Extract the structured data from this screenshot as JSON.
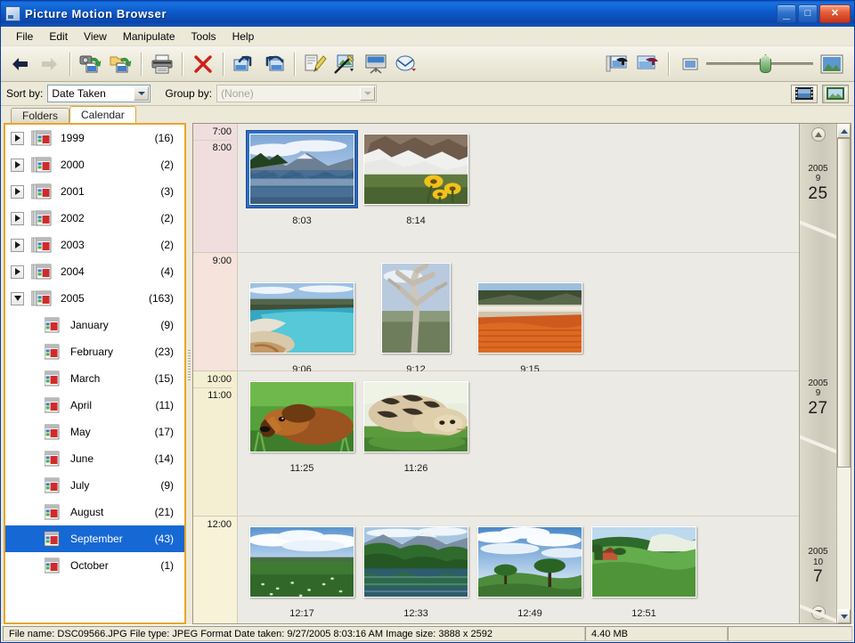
{
  "window": {
    "title": "Picture Motion Browser",
    "icon": "app-window-icon",
    "minimize_label": "_",
    "maximize_label": "□",
    "close_label": "✕"
  },
  "menubar": {
    "items": [
      {
        "label": "File"
      },
      {
        "label": "Edit"
      },
      {
        "label": "View"
      },
      {
        "label": "Manipulate"
      },
      {
        "label": "Tools"
      },
      {
        "label": "Help"
      }
    ]
  },
  "toolbar": {
    "buttons": [
      {
        "name": "back-button",
        "icon": "back-arrow-icon",
        "enabled": true
      },
      {
        "name": "forward-button",
        "icon": "forward-arrow-icon",
        "enabled": false
      },
      {
        "name": "import-camera-button",
        "icon": "camera-import-icon",
        "enabled": true
      },
      {
        "name": "import-folder-button",
        "icon": "folder-import-icon",
        "enabled": true
      },
      {
        "name": "print-button",
        "icon": "printer-icon",
        "enabled": true
      },
      {
        "name": "delete-button",
        "icon": "red-x-delete-icon",
        "enabled": true
      },
      {
        "name": "rotate-left-button",
        "icon": "rotate-left-icon",
        "enabled": true
      },
      {
        "name": "rotate-right-button",
        "icon": "rotate-right-icon",
        "enabled": true
      },
      {
        "name": "edit-image-button",
        "icon": "pencil-edit-icon",
        "enabled": true
      },
      {
        "name": "correct-image-button",
        "icon": "wand-correct-icon",
        "enabled": true
      },
      {
        "name": "slideshow-button",
        "icon": "slideshow-screen-icon",
        "enabled": true
      },
      {
        "name": "email-button",
        "icon": "email-send-icon",
        "enabled": true
      },
      {
        "name": "print-layout-button",
        "icon": "print-layout-icon",
        "enabled": true
      },
      {
        "name": "share-button",
        "icon": "share-icon",
        "enabled": true
      }
    ],
    "zoom": {
      "small_icon": "small-thumbnail-icon",
      "large_icon": "large-thumbnail-icon",
      "value": 50
    }
  },
  "sortbar": {
    "sort_label": "Sort by:",
    "sort_value": "Date Taken",
    "group_label": "Group by:",
    "group_value": "(None)",
    "view_buttons": [
      {
        "name": "view-filmstrip-button",
        "icon": "filmstrip-view-icon",
        "active": false
      },
      {
        "name": "view-single-button",
        "icon": "single-image-view-icon",
        "active": true
      }
    ]
  },
  "sidebar": {
    "tabs": [
      {
        "label": "Folders",
        "active": false
      },
      {
        "label": "Calendar",
        "active": true
      }
    ],
    "tree": [
      {
        "label": "1999",
        "count": "(16)",
        "level": 0,
        "expanded": false,
        "selected": false
      },
      {
        "label": "2000",
        "count": "(2)",
        "level": 0,
        "expanded": false,
        "selected": false
      },
      {
        "label": "2001",
        "count": "(3)",
        "level": 0,
        "expanded": false,
        "selected": false
      },
      {
        "label": "2002",
        "count": "(2)",
        "level": 0,
        "expanded": false,
        "selected": false
      },
      {
        "label": "2003",
        "count": "(2)",
        "level": 0,
        "expanded": false,
        "selected": false
      },
      {
        "label": "2004",
        "count": "(4)",
        "level": 0,
        "expanded": false,
        "selected": false
      },
      {
        "label": "2005",
        "count": "(163)",
        "level": 0,
        "expanded": true,
        "selected": false
      },
      {
        "label": "January",
        "count": "(9)",
        "level": 1,
        "selected": false
      },
      {
        "label": "February",
        "count": "(23)",
        "level": 1,
        "selected": false
      },
      {
        "label": "March",
        "count": "(15)",
        "level": 1,
        "selected": false
      },
      {
        "label": "April",
        "count": "(11)",
        "level": 1,
        "selected": false
      },
      {
        "label": "May",
        "count": "(17)",
        "level": 1,
        "selected": false
      },
      {
        "label": "June",
        "count": "(14)",
        "level": 1,
        "selected": false
      },
      {
        "label": "July",
        "count": "(9)",
        "level": 1,
        "selected": false
      },
      {
        "label": "August",
        "count": "(21)",
        "level": 1,
        "selected": false
      },
      {
        "label": "September",
        "count": "(43)",
        "level": 1,
        "selected": true
      },
      {
        "label": "October",
        "count": "(1)",
        "level": 1,
        "selected": false
      }
    ]
  },
  "timeline": {
    "hour_labels": [
      "7:00",
      "8:00",
      "9:00",
      "10:00",
      "11:00",
      "12:00"
    ],
    "groups": [
      {
        "hours": [
          "7:00",
          "8:00"
        ],
        "band_color": "#f0dede",
        "thumbs": [
          {
            "time": "8:03",
            "orientation": "landscape",
            "selected": true,
            "scene": "mountain-lake-reflection"
          },
          {
            "time": "8:14",
            "orientation": "landscape",
            "selected": false,
            "scene": "snowy-mountain-sunflowers"
          }
        ]
      },
      {
        "hours": [
          "9:00"
        ],
        "band_color": "#f5e3dc",
        "thumbs": [
          {
            "time": "9:06",
            "orientation": "landscape",
            "selected": false,
            "scene": "blue-hot-spring"
          },
          {
            "time": "9:12",
            "orientation": "portrait",
            "selected": false,
            "scene": "dead-tree-branch"
          },
          {
            "time": "9:15",
            "orientation": "landscape",
            "selected": false,
            "scene": "orange-hot-spring"
          }
        ]
      },
      {
        "hours": [
          "10:00",
          "11:00"
        ],
        "band_color": "#f4efd2",
        "thumbs": [
          {
            "time": "11:25",
            "orientation": "landscape",
            "selected": false,
            "scene": "dachshund-puppy-grass"
          },
          {
            "time": "11:26",
            "orientation": "landscape",
            "selected": false,
            "scene": "tabby-kitten-grass"
          }
        ]
      },
      {
        "hours": [
          "12:00"
        ],
        "band_color": "#f7f2d8",
        "thumbs": [
          {
            "time": "12:17",
            "orientation": "landscape",
            "selected": false,
            "scene": "flower-meadow-clouds"
          },
          {
            "time": "12:33",
            "orientation": "landscape",
            "selected": false,
            "scene": "lake-forest-reflection"
          },
          {
            "time": "12:49",
            "orientation": "landscape",
            "selected": false,
            "scene": "two-trees-hill-sky"
          },
          {
            "time": "12:51",
            "orientation": "landscape",
            "selected": false,
            "scene": "green-hill-farmhouse"
          }
        ]
      }
    ]
  },
  "date_ruler": {
    "scroll_up_icon": "scroll-up-arrow-icon",
    "scroll_down_icon": "scroll-down-arrow-icon",
    "marks": [
      {
        "year": "2005",
        "month": "9",
        "day": "25",
        "top_pct": 4
      },
      {
        "year": "2005",
        "month": "9",
        "day": "27",
        "top_pct": 51
      },
      {
        "year": "2005",
        "month": "10",
        "day": "7",
        "top_pct": 88
      }
    ]
  },
  "statusbar": {
    "file_info": "File name: DSC09566.JPG   File type: JPEG Format   Date taken: 9/27/2005 8:03:16 AM   Image size: 3888 x 2592",
    "file_size": "4.40 MB",
    "extra": ""
  },
  "colors": {
    "titlebar_blue": "#0d5bcc",
    "selection_blue": "#1668d4",
    "tab_accent_orange": "#e8a52e",
    "chrome_beige": "#ece9d8"
  }
}
